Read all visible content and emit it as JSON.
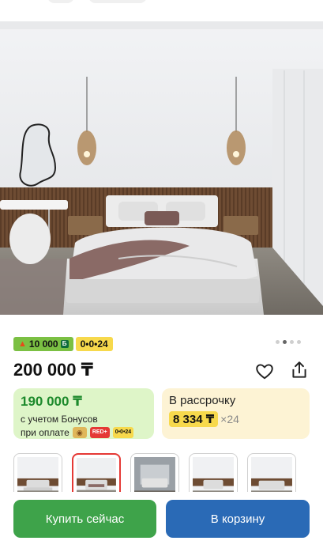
{
  "product": {
    "bonus_badge": "10 000",
    "bonus_coin": "Б",
    "installment_badge": "0•0•24",
    "price": "200 000 ₸",
    "gallery_total": 4,
    "gallery_active": 1
  },
  "bonus_card": {
    "price": "190 000 ₸",
    "line1": "с учетом Бонусов",
    "line2": "при оплате",
    "badge_red": "RED+",
    "badge_024": "0•0•24"
  },
  "credit_card": {
    "label": "В рассрочку",
    "amount": "8 334 ₸",
    "times": "×24"
  },
  "actions": {
    "buy_now": "Купить сейчас",
    "add_to_cart": "В корзину"
  },
  "icons": {
    "favorite": "heart-icon",
    "share": "share-icon",
    "bonus": "flame-icon"
  },
  "colors": {
    "bonus_green": "#7bc043",
    "installment_yellow": "#f7d94c",
    "buy_green": "#3ea34a",
    "cart_blue": "#2a6ab6",
    "active_thumb": "#e53935"
  }
}
